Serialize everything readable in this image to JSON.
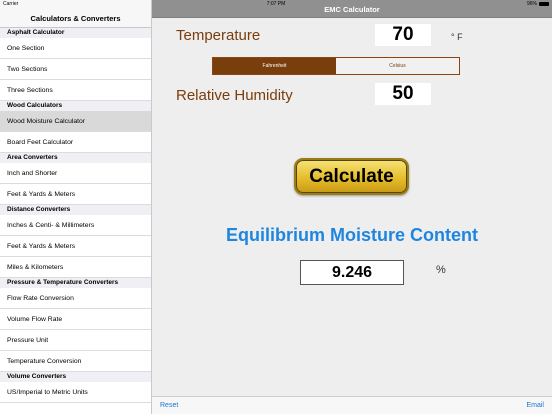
{
  "status": {
    "carrier": "Carrier",
    "time": "7:07 PM",
    "battery": "96%"
  },
  "sidebar": {
    "title": "Calculators & Converters",
    "sections": [
      {
        "header": "Asphalt Calculator",
        "items": [
          "One Section",
          "Two Sections",
          "Three Sections"
        ]
      },
      {
        "header": "Wood Calculators",
        "items": [
          "Wood Moisture Calculator",
          "Board Feet Calculator"
        ]
      },
      {
        "header": "Area Converters",
        "items": [
          "Inch and Shorter",
          "Feet & Yards & Meters"
        ]
      },
      {
        "header": "Distance Converters",
        "items": [
          "Inches & Centi- & Millimeters",
          "Feet & Yards & Meters",
          "Miles & Kilometers"
        ]
      },
      {
        "header": "Pressure & Temperature Converters",
        "items": [
          "Flow Rate Conversion",
          "Volume Flow Rate",
          "Pressure Unit",
          "Temperature Conversion"
        ]
      },
      {
        "header": "Volume Converters",
        "items": [
          "US/Imperial to Metric Units"
        ]
      }
    ],
    "selected": "Wood Moisture Calculator"
  },
  "main": {
    "title": "EMC Calculator",
    "temperature_label": "Temperature",
    "temperature_value": "70",
    "temperature_unit": "° F",
    "segments": [
      "Fahrenheit",
      "Celsius"
    ],
    "humidity_label": "Relative Humidity",
    "humidity_value": "50",
    "calculate_label": "Calculate",
    "result_title": "Equilibrium Moisture Content",
    "result_value": "9.246",
    "result_unit": "%"
  },
  "toolbar": {
    "reset_label": "Reset",
    "email_label": "Email"
  },
  "colors": {
    "brown": "#7a3d0c",
    "blue": "#1f86e0",
    "link": "#1976d2",
    "navbar": "#909090"
  }
}
